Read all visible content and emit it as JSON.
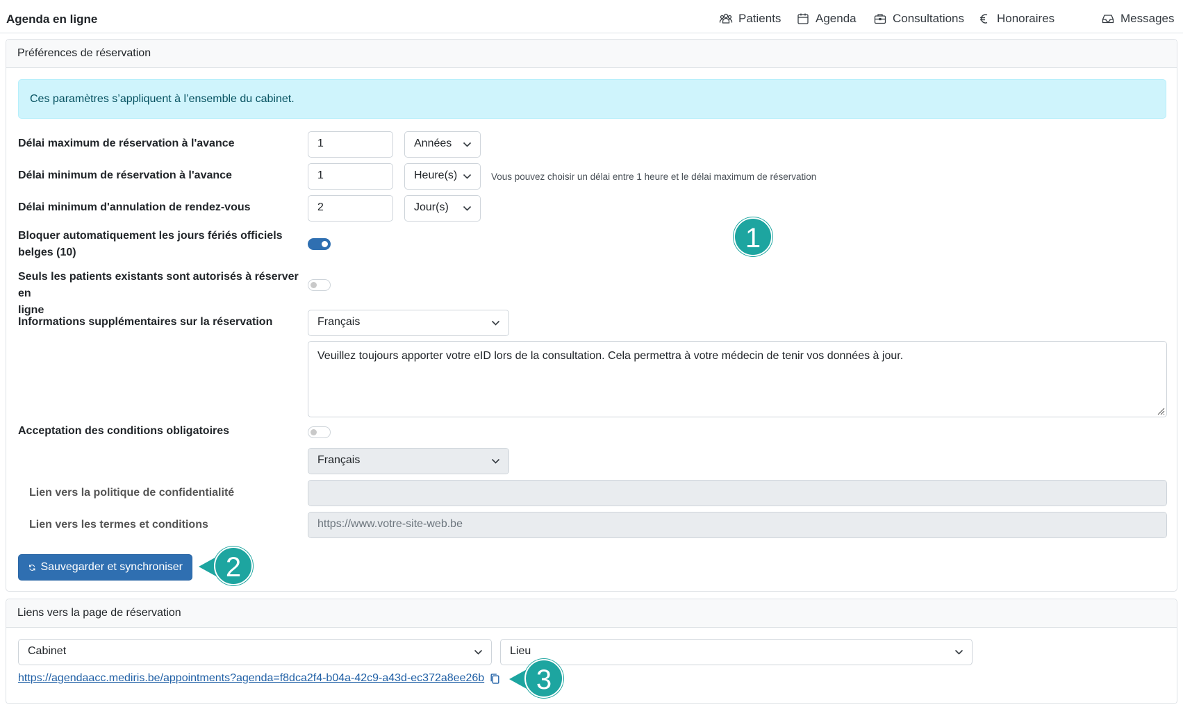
{
  "app": {
    "title": "Agenda en ligne"
  },
  "nav": {
    "patients": "Patients",
    "agenda": "Agenda",
    "consultations": "Consultations",
    "honoraires": "Honoraires",
    "messages": "Messages"
  },
  "prefs": {
    "header": "Préférences de réservation",
    "alert": "Ces paramètres s’appliquent à l’ensemble du cabinet.",
    "max_delay": {
      "label": "Délai maximum de réservation à l'avance",
      "value": "1",
      "unit": "Années"
    },
    "min_delay": {
      "label": "Délai minimum de réservation à l'avance",
      "value": "1",
      "unit": "Heure(s)",
      "hint": "Vous pouvez choisir un délai entre 1 heure et le délai maximum de réservation"
    },
    "cancel_delay": {
      "label": "Délai minimum d'annulation de rendez-vous",
      "value": "2",
      "unit": "Jour(s)"
    },
    "block_holidays": {
      "label_line1": "Bloquer automatiquement les jours fériés officiels",
      "label_line2": "belges (10)",
      "enabled": true
    },
    "existing_only": {
      "label_line1": "Seuls les patients existants sont autorisés à réserver en",
      "label_line2": "ligne",
      "enabled": false
    },
    "extra_info": {
      "label": "Informations supplémentaires sur la réservation",
      "language": "Français",
      "text": "Veuillez toujours apporter votre eID lors de la consultation. Cela permettra à votre médecin de tenir vos données à jour."
    },
    "conditions": {
      "label": "Acceptation des conditions obligatoires",
      "enabled": false,
      "language": "Français",
      "privacy_label": "Lien vers la politique de confidentialité",
      "privacy_value": "",
      "terms_label": "Lien vers les termes et conditions",
      "terms_placeholder": "https://www.votre-site-web.be"
    },
    "save_button": "Sauvegarder et synchroniser"
  },
  "links": {
    "header": "Liens vers la page de réservation",
    "cabinet_select": "Cabinet",
    "lieu_select": "Lieu",
    "url": "https://agendaacc.mediris.be/appointments?agenda=f8dca2f4-b04a-42c9-a43d-ec372a8ee26b"
  },
  "annotations": {
    "badge1": "1",
    "badge2": "2",
    "badge3": "3"
  },
  "colors": {
    "primary": "#2f6fb1",
    "annotation": "#1da5a0",
    "alert_bg": "#cff4fc",
    "alert_text": "#055160"
  }
}
